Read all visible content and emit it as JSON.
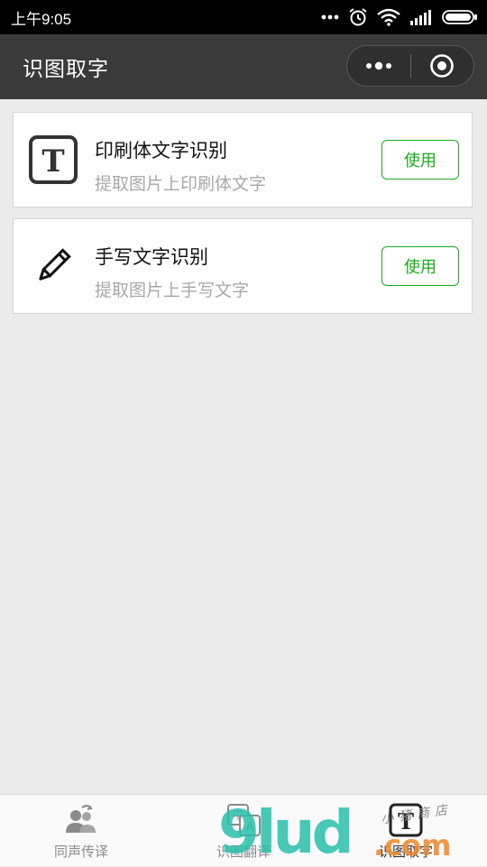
{
  "status_bar": {
    "time": "上午9:05"
  },
  "nav": {
    "title": "识图取字"
  },
  "cards": [
    {
      "title": "印刷体文字识别",
      "subtitle": "提取图片上印刷体文字",
      "button_label": "使用",
      "icon": "text-t-icon"
    },
    {
      "title": "手写文字识别",
      "subtitle": "提取图片上手写文字",
      "button_label": "使用",
      "icon": "pencil-icon"
    }
  ],
  "tabs": [
    {
      "label": "同声传译",
      "icon": "people-icon"
    },
    {
      "label": "识图翻译",
      "icon": "image-translate-icon"
    },
    {
      "label": "识图取字",
      "icon": "text-t-icon",
      "active": true
    }
  ],
  "watermark": {
    "main": "9lud",
    "suffix": ".com",
    "shop": "小猪商店"
  },
  "colors": {
    "accent": "#1aad19",
    "nav_bg": "#3a3a3a",
    "page_bg": "#ebebeb"
  }
}
